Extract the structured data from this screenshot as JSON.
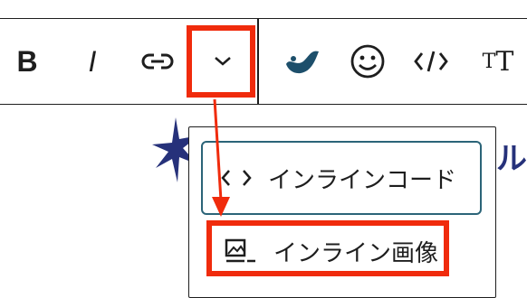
{
  "toolbar": {
    "bold_label": "B",
    "italic_label": "I",
    "format_label_small": "T",
    "format_label_large": "T",
    "icons": [
      "bold",
      "italic",
      "link-icon",
      "chevron-down-icon",
      "ruby-icon",
      "emoji-icon",
      "code-icon",
      "text-format-icon"
    ]
  },
  "dropdown": {
    "items": [
      {
        "label": "インラインコード",
        "icon": "inline-code-icon"
      },
      {
        "label": "インライン画像",
        "icon": "inline-image-icon"
      }
    ]
  },
  "background": {
    "partial_text": "ル"
  },
  "colors": {
    "annotation_red": "#f02b0c",
    "focus_ring": "#2b6478",
    "star_navy": "#26317a",
    "ruby_blue": "#1d4f6b"
  }
}
